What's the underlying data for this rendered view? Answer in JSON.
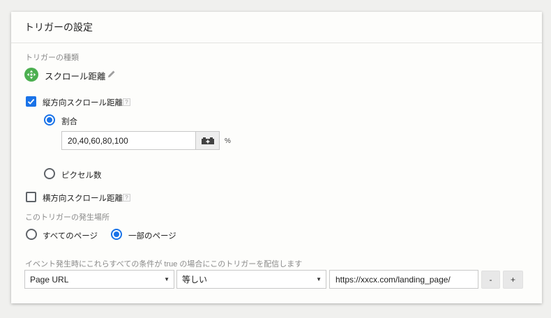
{
  "card": {
    "title": "トリガーの設定",
    "trigger_type_label": "トリガーの種類",
    "trigger_type_name": "スクロール距離",
    "trigger_icon_color": "#4caf50"
  },
  "vertical": {
    "label": "縦方向スクロール距離",
    "checked": true,
    "help": "?",
    "options": {
      "percent_label": "割合",
      "percent_value": "20,40,60,80,100",
      "percent_unit": "%",
      "pixels_label": "ピクセル数"
    }
  },
  "horizontal": {
    "label": "横方向スクロール距離",
    "checked": false,
    "help": "?"
  },
  "fire_on": {
    "label": "このトリガーの発生場所",
    "all_pages": "すべてのページ",
    "some_pages": "一部のページ"
  },
  "condition": {
    "label": "イベント発生時にこれらすべての条件が true の場合にこのトリガーを配信します",
    "variable": "Page URL",
    "operator": "等しい",
    "value": "https://xxcx.com/landing_page/",
    "remove_label": "-",
    "add_label": "+"
  },
  "colors": {
    "accent": "#1a73e8",
    "background": "#f0f0ee",
    "card": "#fdfdfb"
  }
}
